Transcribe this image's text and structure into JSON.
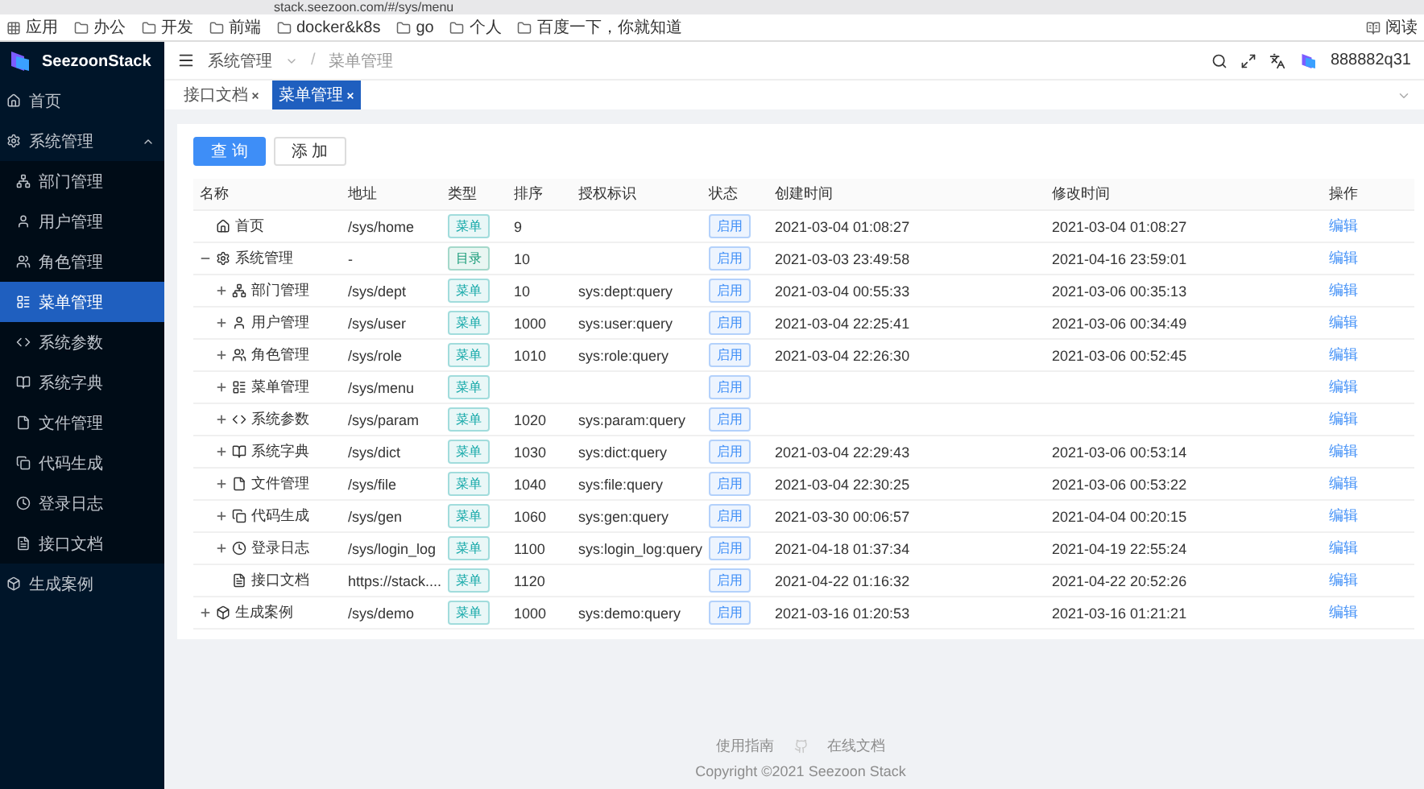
{
  "browser": {
    "url": "stack.seezoon.com/#/sys/menu",
    "bookmarks": [
      "应用",
      "办公",
      "开发",
      "前端",
      "docker&k8s",
      "go",
      "个人",
      "百度一下，你就知道"
    ],
    "reading_list": "阅读"
  },
  "sidebar": {
    "brand": "SeezoonStack",
    "items": [
      {
        "label": "首页",
        "selected": false
      },
      {
        "label": "系统管理",
        "selected": false,
        "expanded": true,
        "children": [
          {
            "label": "部门管理",
            "selected": false
          },
          {
            "label": "用户管理",
            "selected": false
          },
          {
            "label": "角色管理",
            "selected": false
          },
          {
            "label": "菜单管理",
            "selected": true
          },
          {
            "label": "系统参数",
            "selected": false
          },
          {
            "label": "系统字典",
            "selected": false
          },
          {
            "label": "文件管理",
            "selected": false
          },
          {
            "label": "代码生成",
            "selected": false
          },
          {
            "label": "登录日志",
            "selected": false
          },
          {
            "label": "接口文档",
            "selected": false
          }
        ]
      },
      {
        "label": "生成案例",
        "selected": false
      }
    ]
  },
  "header": {
    "breadcrumb": [
      "系统管理",
      "菜单管理"
    ],
    "separator": "/",
    "user": "888882q31"
  },
  "tabs": [
    {
      "label": "接口文档",
      "selected": false
    },
    {
      "label": "菜单管理",
      "selected": true
    }
  ],
  "buttons": [
    {
      "label": "查 询",
      "kind": "primary"
    },
    {
      "label": "添 加",
      "kind": "default"
    }
  ],
  "table": {
    "columns": [
      "名称",
      "地址",
      "类型",
      "排序",
      "授权标识",
      "状态",
      "创建时间",
      "修改时间",
      "操作"
    ],
    "rows": [
      {
        "name": "首页",
        "path": "/sys/home",
        "type": {
          "label": "菜单",
          "kind": "menu"
        },
        "sort": "9",
        "status": "启用",
        "created": "2021-03-04 01:08:27",
        "modified": "2021-03-04 01:08:27",
        "action": "编辑"
      },
      {
        "name": "系统管理",
        "path": "-",
        "type": {
          "label": "目录",
          "kind": "dir"
        },
        "sort": "10",
        "status": "启用",
        "created": "2021-03-03 23:49:58",
        "modified": "2021-04-16 23:59:01",
        "action": "编辑",
        "expanded": true,
        "children": [
          {
            "name": "部门管理",
            "path": "/sys/dept",
            "type": {
              "label": "菜单",
              "kind": "menu"
            },
            "sort": "10",
            "permission": "sys:dept:query",
            "status": "启用",
            "created": "2021-03-04 00:55:33",
            "modified": "2021-03-06 00:35:13",
            "action": "编辑",
            "expanded": false
          },
          {
            "name": "用户管理",
            "path": "/sys/user",
            "type": {
              "label": "菜单",
              "kind": "menu"
            },
            "sort": "1000",
            "permission": "sys:user:query",
            "status": "启用",
            "created": "2021-03-04 22:25:41",
            "modified": "2021-03-06 00:34:49",
            "action": "编辑",
            "expanded": false
          },
          {
            "name": "角色管理",
            "path": "/sys/role",
            "type": {
              "label": "菜单",
              "kind": "menu"
            },
            "sort": "1010",
            "permission": "sys:role:query",
            "status": "启用",
            "created": "2021-03-04 22:26:30",
            "modified": "2021-03-06 00:52:45",
            "action": "编辑",
            "expanded": false
          },
          {
            "name": "菜单管理",
            "path": "/sys/menu",
            "type": {
              "label": "菜单",
              "kind": "menu"
            },
            "status": "启用",
            "action": "编辑",
            "expanded": false
          },
          {
            "name": "系统参数",
            "path": "/sys/param",
            "type": {
              "label": "菜单",
              "kind": "menu"
            },
            "sort": "1020",
            "permission": "sys:param:query",
            "status": "启用",
            "action": "编辑",
            "expanded": false
          },
          {
            "name": "系统字典",
            "path": "/sys/dict",
            "type": {
              "label": "菜单",
              "kind": "menu"
            },
            "sort": "1030",
            "permission": "sys:dict:query",
            "status": "启用",
            "created": "2021-03-04 22:29:43",
            "modified": "2021-03-06 00:53:14",
            "action": "编辑",
            "expanded": false
          },
          {
            "name": "文件管理",
            "path": "/sys/file",
            "type": {
              "label": "菜单",
              "kind": "menu"
            },
            "sort": "1040",
            "permission": "sys:file:query",
            "status": "启用",
            "created": "2021-03-04 22:30:25",
            "modified": "2021-03-06 00:53:22",
            "action": "编辑",
            "expanded": false
          },
          {
            "name": "代码生成",
            "path": "/sys/gen",
            "type": {
              "label": "菜单",
              "kind": "menu"
            },
            "sort": "1060",
            "permission": "sys:gen:query",
            "status": "启用",
            "created": "2021-03-30 00:06:57",
            "modified": "2021-04-04 00:20:15",
            "action": "编辑",
            "expanded": false
          },
          {
            "name": "登录日志",
            "path": "/sys/login_log",
            "type": {
              "label": "菜单",
              "kind": "menu"
            },
            "sort": "1100",
            "permission": "sys:login_log:query",
            "status": "启用",
            "created": "2021-04-18 01:37:34",
            "modified": "2021-04-19 22:55:24",
            "action": "编辑",
            "expanded": false
          },
          {
            "name": "接口文档",
            "path": "https://stack....",
            "type": {
              "label": "菜单",
              "kind": "menu"
            },
            "sort": "1120",
            "status": "启用",
            "created": "2021-04-22 01:16:32",
            "modified": "2021-04-22 20:52:26",
            "action": "编辑"
          }
        ]
      },
      {
        "name": "生成案例",
        "path": "/sys/demo",
        "type": {
          "label": "菜单",
          "kind": "menu"
        },
        "sort": "1000",
        "permission": "sys:demo:query",
        "status": "启用",
        "created": "2021-03-16 01:20:53",
        "modified": "2021-03-16 01:21:21",
        "action": "编辑",
        "expanded": false
      }
    ]
  },
  "footer": {
    "links": [
      "使用指南",
      "在线文档"
    ],
    "copyright": "Copyright ©2021 Seezoon Stack"
  }
}
